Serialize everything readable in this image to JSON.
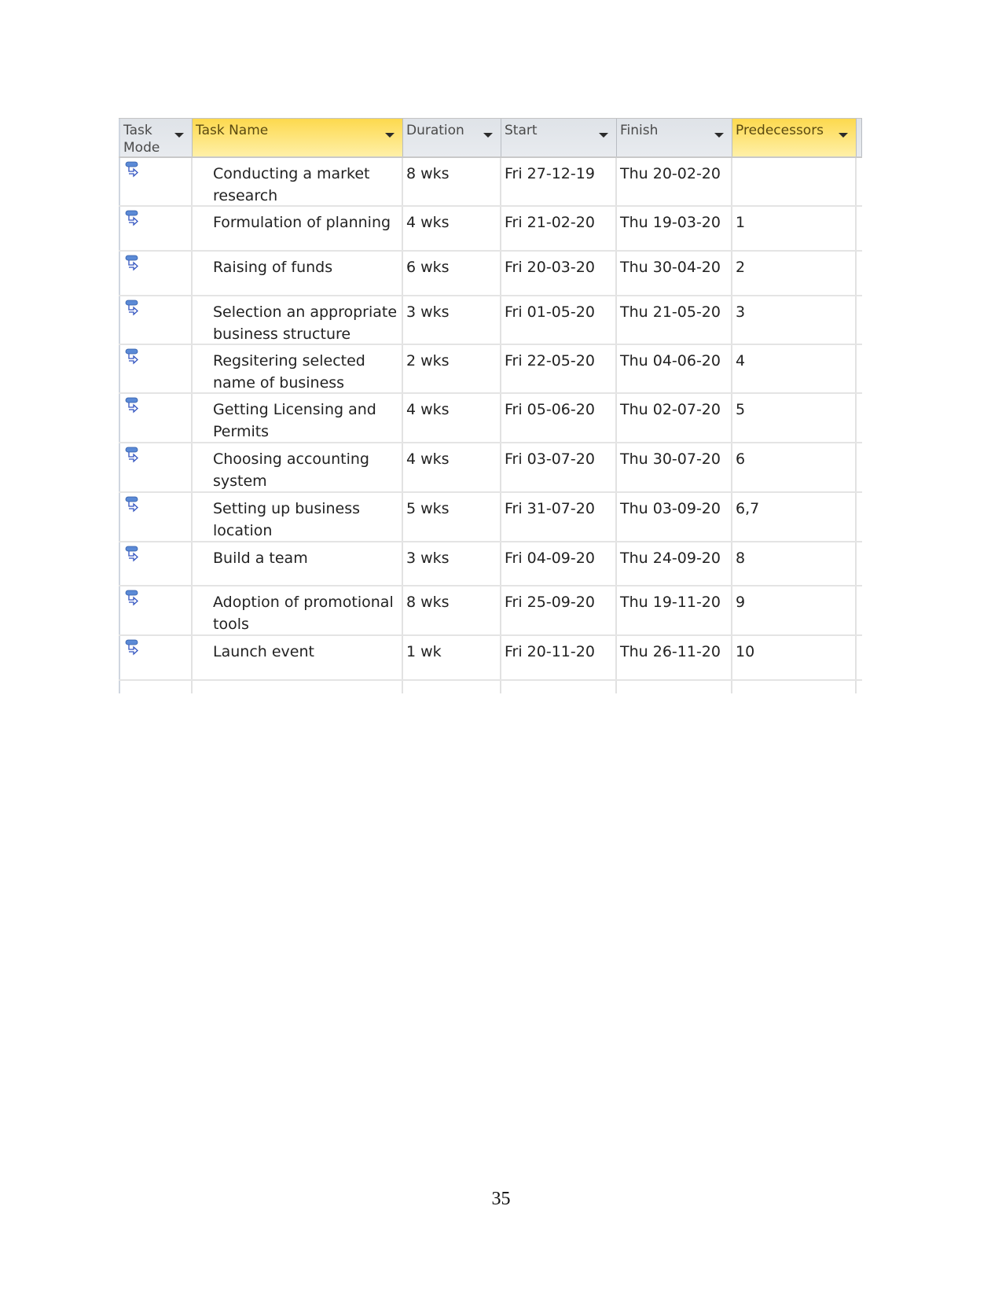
{
  "table": {
    "columns": [
      {
        "key": "mode",
        "label": "Task Mode"
      },
      {
        "key": "name",
        "label": "Task Name"
      },
      {
        "key": "duration",
        "label": "Duration"
      },
      {
        "key": "start",
        "label": "Start"
      },
      {
        "key": "finish",
        "label": "Finish"
      },
      {
        "key": "predecessors",
        "label": "Predecessors"
      }
    ],
    "header": {
      "mode": "Task\nMode",
      "name": "Task Name",
      "duration": "Duration",
      "start": "Start",
      "finish": "Finish",
      "predecessors": "Predecessors"
    },
    "mode_icon": "auto-scheduled-task-icon",
    "rows": [
      {
        "name": "Conducting a market research",
        "duration": "8 wks",
        "start": "Fri 27-12-19",
        "finish": "Thu 20-02-20",
        "predecessors": ""
      },
      {
        "name": "Formulation of planning",
        "duration": "4 wks",
        "start": "Fri 21-02-20",
        "finish": "Thu 19-03-20",
        "predecessors": "1"
      },
      {
        "name": "Raising of funds",
        "duration": "6 wks",
        "start": "Fri 20-03-20",
        "finish": "Thu 30-04-20",
        "predecessors": "2"
      },
      {
        "name": "Selection an appropriate business structure",
        "duration": "3 wks",
        "start": "Fri 01-05-20",
        "finish": "Thu 21-05-20",
        "predecessors": "3"
      },
      {
        "name": "Regsitering selected name of business",
        "duration": "2 wks",
        "start": "Fri 22-05-20",
        "finish": "Thu 04-06-20",
        "predecessors": "4"
      },
      {
        "name": "Getting Licensing and Permits",
        "duration": "4 wks",
        "start": "Fri 05-06-20",
        "finish": "Thu 02-07-20",
        "predecessors": "5"
      },
      {
        "name": "Choosing accounting system",
        "duration": "4 wks",
        "start": "Fri 03-07-20",
        "finish": "Thu 30-07-20",
        "predecessors": "6"
      },
      {
        "name": "Setting up business location",
        "duration": "5 wks",
        "start": "Fri 31-07-20",
        "finish": "Thu 03-09-20",
        "predecessors": "6,7"
      },
      {
        "name": "Build a team",
        "duration": "3 wks",
        "start": "Fri 04-09-20",
        "finish": "Thu 24-09-20",
        "predecessors": "8"
      },
      {
        "name": "Adoption of promotional tools",
        "duration": "8 wks",
        "start": "Fri 25-09-20",
        "finish": "Thu 19-11-20",
        "predecessors": "9"
      },
      {
        "name": "Launch event",
        "duration": "1 wk",
        "start": "Fri 20-11-20",
        "finish": "Thu 26-11-20",
        "predecessors": "10"
      }
    ]
  },
  "colors": {
    "selected_header": "#fdd94e",
    "header_bg": "#e3e6ea",
    "gridline": "#e2e2e2",
    "icon_blue": "#4a78c8"
  },
  "page_number": "35"
}
